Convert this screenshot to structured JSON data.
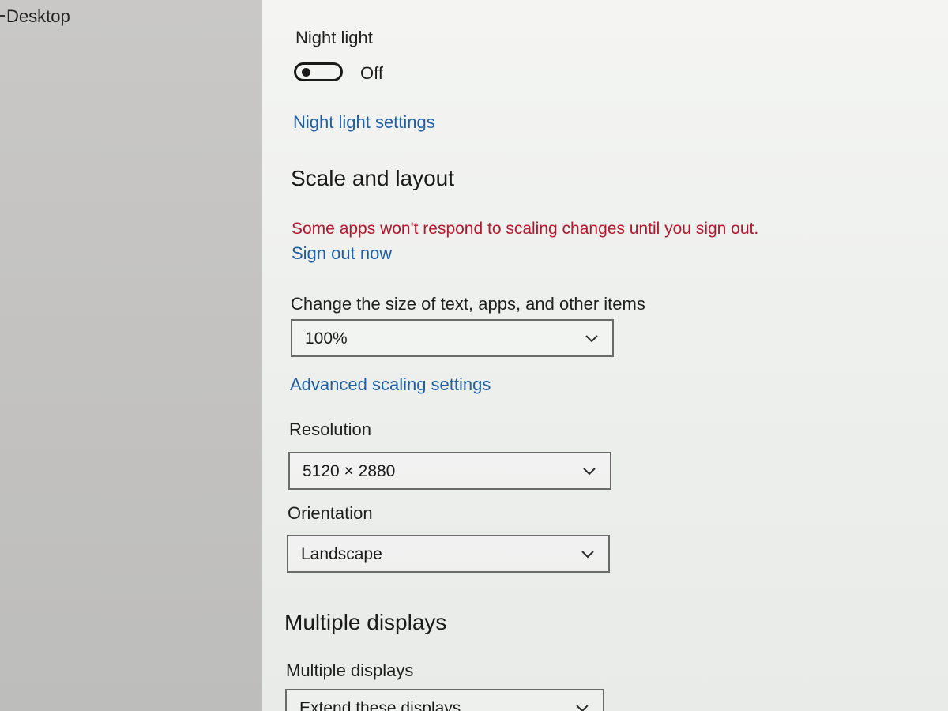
{
  "left_nav": {
    "item_label": "Desktop"
  },
  "night_light": {
    "label": "Night light",
    "toggle_state": "Off",
    "settings_link": "Night light settings"
  },
  "scale_layout": {
    "heading": "Scale and layout",
    "warning": "Some apps won't respond to scaling changes until you sign out.",
    "sign_out_link": "Sign out now",
    "size_label": "Change the size of text, apps, and other items",
    "size_value": "100%",
    "advanced_link": "Advanced scaling settings",
    "resolution_label": "Resolution",
    "resolution_value": "5120 × 2880",
    "orientation_label": "Orientation",
    "orientation_value": "Landscape"
  },
  "multiple_displays": {
    "heading": "Multiple displays",
    "label": "Multiple displays",
    "value": "Extend these displays"
  },
  "colors": {
    "link": "#1f5fa8",
    "warning": "#b5172b",
    "left_pane": "#c4c3c1",
    "main_bg": "#eef0ee"
  }
}
